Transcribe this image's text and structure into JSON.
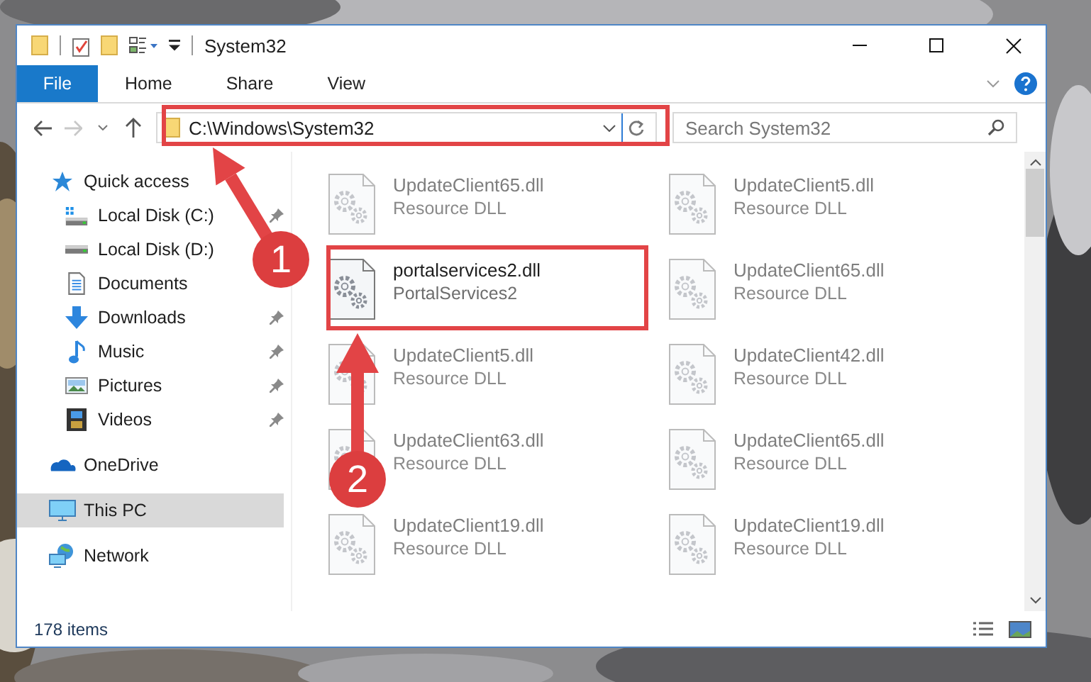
{
  "window": {
    "title": "System32"
  },
  "ribbon_tabs": [
    {
      "label": "File",
      "selected": true
    },
    {
      "label": "Home",
      "selected": false
    },
    {
      "label": "Share",
      "selected": false
    },
    {
      "label": "View",
      "selected": false
    }
  ],
  "address_bar": {
    "path": "C:\\Windows\\System32"
  },
  "search": {
    "placeholder": "Search System32"
  },
  "sidebar": {
    "items": [
      {
        "label": "Quick access",
        "kind": "star",
        "selected": false,
        "children": [
          {
            "label": "Local Disk (C:)",
            "kind": "disk-c",
            "pinned": true,
            "selected": false
          },
          {
            "label": "Local Disk (D:)",
            "kind": "disk",
            "selected": false
          },
          {
            "label": "Documents",
            "kind": "documents",
            "selected": false
          },
          {
            "label": "Downloads",
            "kind": "downloads",
            "pinned": true,
            "selected": false
          },
          {
            "label": "Music",
            "kind": "music",
            "pinned": true,
            "selected": false
          },
          {
            "label": "Pictures",
            "kind": "pictures",
            "pinned": true,
            "selected": false
          },
          {
            "label": "Videos",
            "kind": "videos",
            "pinned": true,
            "selected": false
          }
        ]
      },
      {
        "label": "OneDrive",
        "kind": "cloud",
        "selected": false
      },
      {
        "label": "This PC",
        "kind": "pc",
        "selected": true
      },
      {
        "label": "Network",
        "kind": "network",
        "selected": false
      }
    ]
  },
  "files": [
    {
      "name": "UpdateClient65.dll",
      "type": "Resource DLL",
      "blurred": true
    },
    {
      "name": "UpdateClient5.dll",
      "type": "Resource DLL",
      "blurred": true
    },
    {
      "name": "portalservices2.dll",
      "type": "PortalServices2",
      "blurred": false
    },
    {
      "name": "UpdateClient65.dll",
      "type": "Resource DLL",
      "blurred": true
    },
    {
      "name": "UpdateClient5.dll",
      "type": "Resource DLL",
      "blurred": true
    },
    {
      "name": "UpdateClient42.dll",
      "type": "Resource DLL",
      "blurred": true
    },
    {
      "name": "UpdateClient63.dll",
      "type": "Resource DLL",
      "blurred": true
    },
    {
      "name": "UpdateClient65.dll",
      "type": "Resource DLL",
      "blurred": true
    },
    {
      "name": "UpdateClient19.dll",
      "type": "Resource DLL",
      "blurred": true
    },
    {
      "name": "UpdateClient19.dll",
      "type": "Resource DLL",
      "blurred": true
    }
  ],
  "status_bar": {
    "count": "178 items"
  },
  "annotations": [
    {
      "number": "1"
    },
    {
      "number": "2"
    }
  ]
}
